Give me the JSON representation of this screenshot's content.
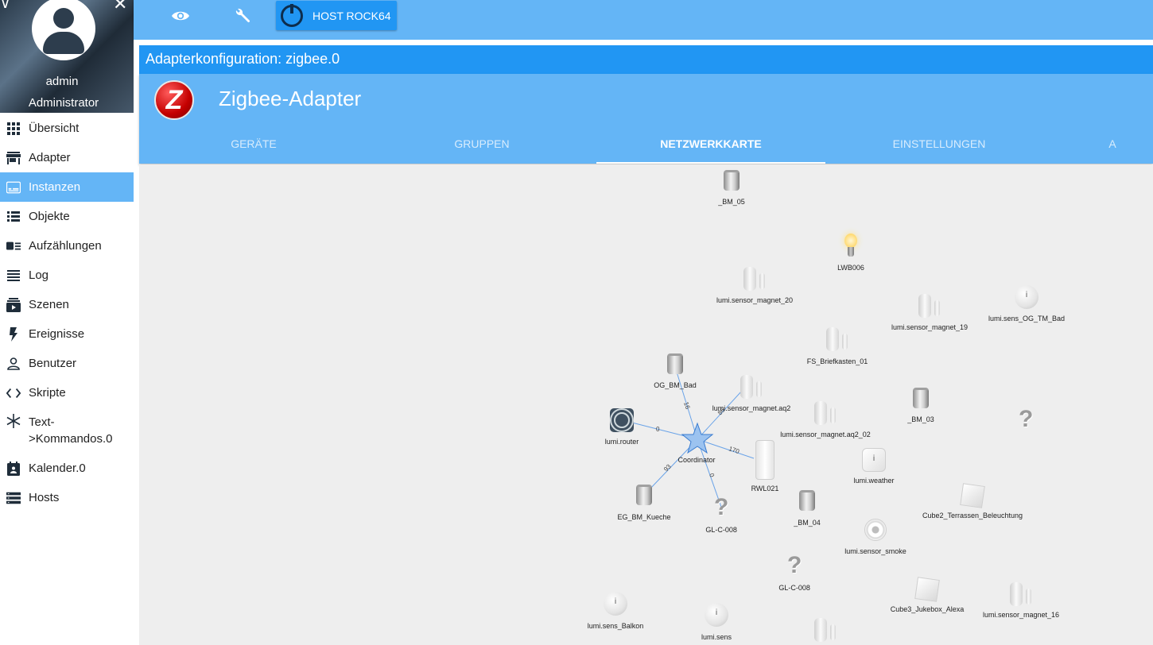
{
  "sidebar": {
    "user_name": "admin",
    "user_role": "Administrator",
    "items": [
      {
        "label": "Übersicht",
        "icon": "apps-grid-icon"
      },
      {
        "label": "Adapter",
        "icon": "store-icon"
      },
      {
        "label": "Instanzen",
        "icon": "instances-icon"
      },
      {
        "label": "Objekte",
        "icon": "list-icon"
      },
      {
        "label": "Aufzählungen",
        "icon": "enum-icon"
      },
      {
        "label": "Log",
        "icon": "log-lines-icon"
      },
      {
        "label": "Szenen",
        "icon": "scenes-icon"
      },
      {
        "label": "Ereignisse",
        "icon": "flash-icon"
      },
      {
        "label": "Benutzer",
        "icon": "user-icon"
      },
      {
        "label": "Skripte",
        "icon": "code-icon"
      },
      {
        "label": "Text->Kommandos.0",
        "icon": "snowflake-icon"
      },
      {
        "label": "Kalender.0",
        "icon": "calendar-icon"
      },
      {
        "label": "Hosts",
        "icon": "hosts-icon"
      }
    ],
    "active_index": 2
  },
  "topbar": {
    "host_button_label": "HOST ROCK64"
  },
  "page": {
    "title": "Adapterkonfiguration: zigbee.0",
    "adapter_name": "Zigbee-Adapter",
    "logo_letter": "Z",
    "tabs": [
      "GERÄTE",
      "GRUPPEN",
      "NETZWERKKARTE",
      "EINSTELLUNGEN",
      "A"
    ],
    "active_tab": 2
  },
  "network_map": {
    "nodes": [
      {
        "label": "_BM_05",
        "device": "motion-sensor"
      },
      {
        "label": "LWB006",
        "device": "bulb"
      },
      {
        "label": "lumi.sensor_magnet_20",
        "device": "door-sensor"
      },
      {
        "label": "lumi.sensor_magnet_19",
        "device": "door-sensor"
      },
      {
        "label": "lumi.sens_OG_TM_Bad",
        "device": "temperature-sensor"
      },
      {
        "label": "FS_Briefkasten_01",
        "device": "door-sensor"
      },
      {
        "label": "OG_BM_Bad",
        "device": "motion-sensor"
      },
      {
        "label": "lumi.sensor_magnet.aq2",
        "device": "door-sensor"
      },
      {
        "label": "lumi.sensor_magnet.aq2_02",
        "device": "door-sensor"
      },
      {
        "label": "_BM_03",
        "device": "motion-sensor"
      },
      {
        "label": "",
        "device": "unknown"
      },
      {
        "label": "lumi.router",
        "device": "router"
      },
      {
        "label": "Coordinator",
        "device": "coordinator"
      },
      {
        "label": "RWL021",
        "device": "remote"
      },
      {
        "label": "lumi.weather",
        "device": "weather-sensor"
      },
      {
        "label": "Cube2_Terrassen_Beleuchtung",
        "device": "cube"
      },
      {
        "label": "EG_BM_Kueche",
        "device": "motion-sensor"
      },
      {
        "label": "GL-C-008",
        "device": "unknown"
      },
      {
        "label": "_BM_04",
        "device": "motion-sensor"
      },
      {
        "label": "lumi.sensor_smoke",
        "device": "smoke-sensor"
      },
      {
        "label": "GL-C-008",
        "device": "unknown"
      },
      {
        "label": "Cube3_Jukebox_Alexa",
        "device": "cube"
      },
      {
        "label": "lumi.sensor_magnet_16",
        "device": "door-sensor"
      },
      {
        "label": "lumi.sens_Balkon",
        "device": "temperature-sensor"
      },
      {
        "label": "lumi.sens",
        "device": "temperature-sensor"
      },
      {
        "label": "",
        "device": "door-sensor"
      }
    ],
    "links": [
      {
        "from": "Coordinator",
        "to": "OG_BM_Bad",
        "lqi": "16"
      },
      {
        "from": "Coordinator",
        "to": "lumi.sensor_magnet.aq2",
        "lqi": "86"
      },
      {
        "from": "Coordinator",
        "to": "lumi.router",
        "lqi": "0"
      },
      {
        "from": "Coordinator",
        "to": "RWL021",
        "lqi": "170"
      },
      {
        "from": "Coordinator",
        "to": "EG_BM_Kueche",
        "lqi": "93"
      },
      {
        "from": "Coordinator",
        "to": "GL-C-008",
        "lqi": "0"
      }
    ]
  }
}
